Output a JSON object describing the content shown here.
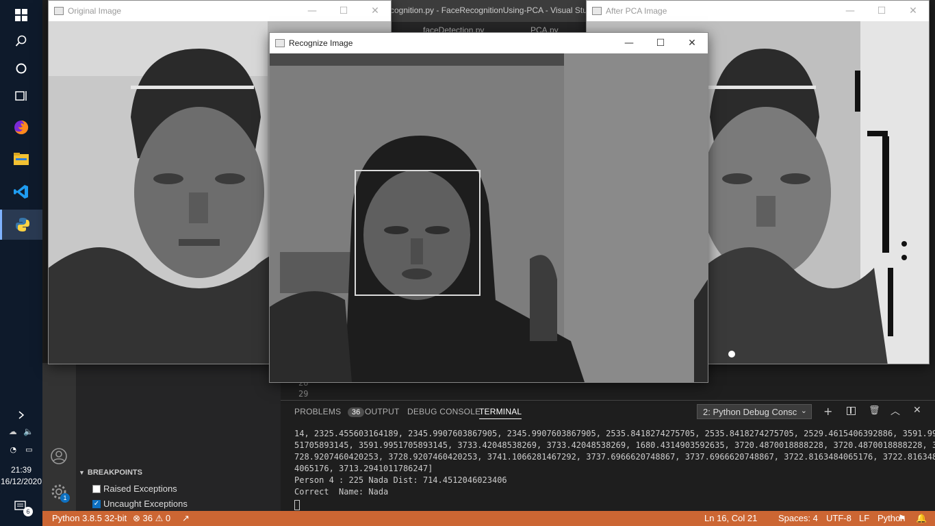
{
  "taskbar": {
    "icons": [
      "windows-start-icon",
      "search-icon",
      "cortana-icon",
      "task-view-icon",
      "firefox-icon",
      "file-explorer-icon",
      "vscode-icon",
      "python-icon"
    ],
    "time": "21:39",
    "date": "16/12/2020",
    "notification_count": "6"
  },
  "vscode": {
    "title_fragment": "cognition.py - FaceRecognitionUsing-PCA - Visual Stu",
    "tab1": "faceDetection.py",
    "tab2": "PCA.py",
    "line_numbers": [
      "28",
      "29"
    ],
    "breakpoints_header": "BREAKPOINTS",
    "breakpoints": [
      {
        "label": "Raised Exceptions",
        "checked": false
      },
      {
        "label": "Uncaught Exceptions",
        "checked": true
      }
    ],
    "settings_badge": "1",
    "panel": {
      "tabs": [
        "PROBLEMS",
        "OUTPUT",
        "DEBUG CONSOLE",
        "TERMINAL"
      ],
      "problems_count": "36",
      "active_tab": "TERMINAL",
      "terminal_select": "2: Python Debug Consc",
      "lines": [
        "14, 2325.455603164189, 2345.9907603867905, 2345.9907603867905, 2535.8418274275705, 2535.8418274275705, 2529.4615406392886, 3591.99",
        "51705893145, 3591.9951705893145, 3733.42048538269, 3733.42048538269, 1680.4314903592635, 3720.4870018888228, 3720.4870018888228, 3",
        "728.9207460420253, 3728.9207460420253, 3741.1066281467292, 3737.6966620748867, 3737.6966620748867, 3722.8163484065176, 3722.816348",
        "4065176, 3713.2941011786247]",
        "Person 4 : 225 Nada Dist: 714.4512046023406",
        "Correct  Name: Nada"
      ]
    },
    "status": {
      "python": "Python 3.8.5 32-bit",
      "errors": "36",
      "warnings": "0",
      "position": "Ln 16, Col 21",
      "spaces": "Spaces: 4",
      "encoding": "UTF-8",
      "eol": "LF",
      "language": "Python"
    }
  },
  "windows": {
    "original": {
      "title": "Original Image"
    },
    "after_pca": {
      "title": "After PCA Image"
    },
    "recognize": {
      "title": "Recognize Image"
    }
  },
  "colors": {
    "statusbar": "#cc6633",
    "taskbar": "#0e1a2b",
    "vscode_panel": "#1e1e1e"
  }
}
